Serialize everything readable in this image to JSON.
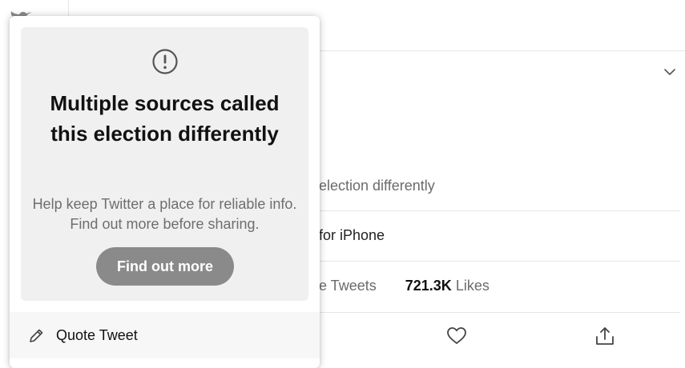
{
  "popup": {
    "icon": "exclamation-circle-icon",
    "title": "Multiple sources called this election differently",
    "body": "Help keep Twitter a place for reliable info. Find out more before sharing.",
    "button_label": "Find out more",
    "quote_icon": "pencil-icon",
    "quote_label": "Quote Tweet"
  },
  "tweet": {
    "text_tail": "!",
    "notice_tail": "election differently",
    "source_tail": "for iPhone",
    "retweets_tail": "e Tweets",
    "likes_count": "721.3K",
    "likes_label": "Likes",
    "like_icon": "heart-icon",
    "share_icon": "share-icon",
    "menu_icon": "chevron-down-icon"
  },
  "colors": {
    "card_bg": "#f0f0f0",
    "button_bg": "#8a8a8a",
    "muted_text": "#6e6e6e"
  }
}
